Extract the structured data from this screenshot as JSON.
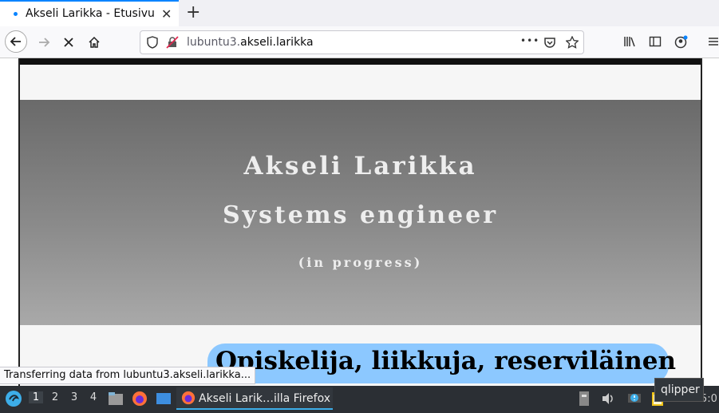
{
  "tab": {
    "title": "Akseli Larikka - Etusivu",
    "close": "✕",
    "new_tab": "+"
  },
  "nav": {
    "url_prefix": "lubuntu3.",
    "url_domain": "akseli.larikka",
    "page_actions": "•••"
  },
  "page": {
    "name": "Akseli Larikka",
    "role": "Systems engineer",
    "progress": "(in progress)",
    "heading": "Opiskelija, liikkuja, reserviläinen"
  },
  "status_text": "Transferring data from lubuntu3.akseli.larikka...",
  "taskbar": {
    "desktops": [
      "1",
      "2",
      "3",
      "4"
    ],
    "window_title": "Akseli Larik…illa Firefox",
    "clock": "5:0"
  },
  "tooltip": "qlipper",
  "colors": {
    "accent": "#0a84ff",
    "pill": "#8cc8ff",
    "taskbar": "#2b2f34"
  }
}
